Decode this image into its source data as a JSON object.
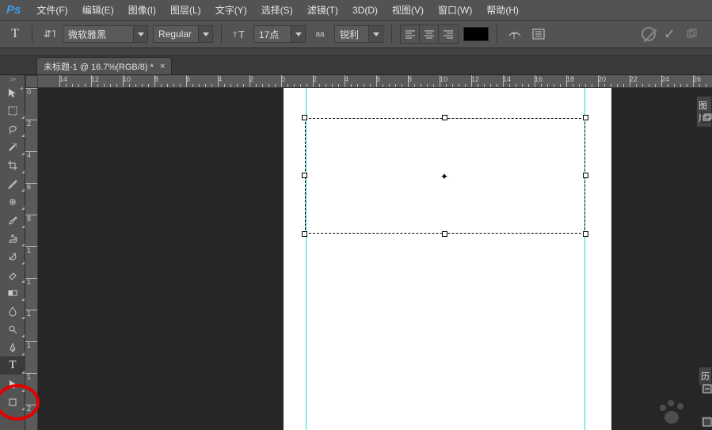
{
  "menu": {
    "items": [
      "文件(F)",
      "编辑(E)",
      "图像(I)",
      "图层(L)",
      "文字(Y)",
      "选择(S)",
      "滤镜(T)",
      "3D(D)",
      "视图(V)",
      "窗口(W)",
      "帮助(H)"
    ]
  },
  "optbar": {
    "font_family": "微软雅黑",
    "font_style": "Regular",
    "font_size": "17点",
    "aa_method": "锐利",
    "aa_label": "aa"
  },
  "doc": {
    "tab_title": "未标题-1 @ 16.7%(RGB/8) *"
  },
  "ruler": {
    "h_labels": [
      {
        "pos": 75,
        "text": "14"
      },
      {
        "pos": 115,
        "text": "12"
      },
      {
        "pos": 155,
        "text": "10"
      },
      {
        "pos": 195,
        "text": "8"
      },
      {
        "pos": 235,
        "text": "6"
      },
      {
        "pos": 275,
        "text": "4"
      },
      {
        "pos": 315,
        "text": "2"
      },
      {
        "pos": 355,
        "text": "0"
      },
      {
        "pos": 395,
        "text": "2"
      },
      {
        "pos": 435,
        "text": "4"
      },
      {
        "pos": 475,
        "text": "6"
      },
      {
        "pos": 515,
        "text": "8"
      },
      {
        "pos": 555,
        "text": "10"
      },
      {
        "pos": 595,
        "text": "12"
      },
      {
        "pos": 635,
        "text": "14"
      },
      {
        "pos": 675,
        "text": "16"
      },
      {
        "pos": 715,
        "text": "18"
      },
      {
        "pos": 755,
        "text": "20"
      },
      {
        "pos": 795,
        "text": "22"
      },
      {
        "pos": 835,
        "text": "24"
      },
      {
        "pos": 875,
        "text": "26"
      }
    ],
    "v_labels": [
      {
        "pos": 0,
        "text": "0"
      },
      {
        "pos": 40,
        "text": "2"
      },
      {
        "pos": 80,
        "text": "4"
      },
      {
        "pos": 120,
        "text": "6"
      },
      {
        "pos": 160,
        "text": "8"
      },
      {
        "pos": 200,
        "text": "1"
      },
      {
        "pos": 240,
        "text": "1"
      },
      {
        "pos": 280,
        "text": "1"
      },
      {
        "pos": 320,
        "text": "1"
      },
      {
        "pos": 360,
        "text": "1"
      },
      {
        "pos": 400,
        "text": "2"
      }
    ]
  },
  "panels": {
    "layers": "图层",
    "history": "历"
  },
  "tools": [
    "move",
    "marquee",
    "lasso",
    "wand",
    "crop",
    "eyedropper",
    "heal",
    "brush",
    "stamp",
    "history-brush",
    "eraser",
    "gradient",
    "blur",
    "dodge",
    "pen",
    "type",
    "path-select",
    "shape"
  ]
}
